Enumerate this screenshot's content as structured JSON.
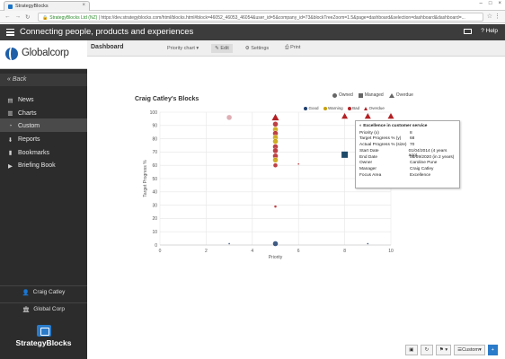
{
  "browser": {
    "tab_title": "StrategyBlocks",
    "url_secure_label": "StrategyBlocks Ltd (NZ)",
    "url": "https://dev.strategyblocks.com/html/blocks.html#block=46052_46053_46054&user_id=5&company_id=73&blockTreeZoom=1.5&page=dashboard&selection=dashboard&dashboard=..."
  },
  "app": {
    "title": "Connecting people, products and experiences",
    "help_label": "Help"
  },
  "sidebar": {
    "logo_main": "Global",
    "logo_accent": "corp",
    "back_label": "Back",
    "items": [
      {
        "label": "News",
        "icon": "newspaper-icon"
      },
      {
        "label": "Charts",
        "icon": "chart-icon"
      },
      {
        "label": "Custom",
        "icon": "dashboard-icon",
        "active": true
      },
      {
        "label": "Reports",
        "icon": "download-icon"
      },
      {
        "label": "Bookmarks",
        "icon": "bookmark-icon"
      },
      {
        "label": "Briefing Book",
        "icon": "book-icon"
      }
    ],
    "user_name": "Craig Catley",
    "company_name": "Global Corp",
    "brand": "StrategyBlocks"
  },
  "toolbar": {
    "dashboard_label": "Dashboard",
    "priority_chart": "Priority chart",
    "edit": "Edit",
    "settings": "Settings",
    "print": "Print"
  },
  "chart": {
    "title": "Craig Catley's Blocks",
    "legend_shapes": [
      "Owned",
      "Managed",
      "Overdue"
    ],
    "legend_status": [
      {
        "label": "Good",
        "color": "#1e3f6e"
      },
      {
        "label": "Warning",
        "color": "#c8a000"
      },
      {
        "label": "Bad",
        "color": "#b32024"
      },
      {
        "label": "Overdue",
        "color": "#b32024"
      }
    ],
    "xlabel": "Priority",
    "ylabel": "Target Progress %"
  },
  "chart_data": {
    "type": "scatter",
    "xlabel": "Priority",
    "ylabel": "Target Progress %",
    "xlim": [
      0,
      10
    ],
    "ylim": [
      0,
      100
    ],
    "x_ticks": [
      0,
      2,
      4,
      6,
      8,
      10
    ],
    "y_ticks": [
      0,
      10,
      20,
      30,
      40,
      50,
      60,
      70,
      80,
      90,
      100
    ],
    "points": [
      {
        "x": 3,
        "y": 96,
        "shape": "circle",
        "color": "#d9a0a8",
        "r": 3
      },
      {
        "x": 5,
        "y": 96,
        "shape": "triangle",
        "color": "#b32024",
        "r": 4
      },
      {
        "x": 5,
        "y": 91,
        "shape": "circle",
        "color": "#b32024",
        "r": 3
      },
      {
        "x": 5,
        "y": 87,
        "shape": "circle",
        "color": "#c8a000",
        "r": 3
      },
      {
        "x": 5,
        "y": 84,
        "shape": "circle",
        "color": "#b32024",
        "r": 3
      },
      {
        "x": 5,
        "y": 81,
        "shape": "circle",
        "color": "#c8a000",
        "r": 3
      },
      {
        "x": 5,
        "y": 78,
        "shape": "circle",
        "color": "#c8a000",
        "r": 3
      },
      {
        "x": 5,
        "y": 74,
        "shape": "circle",
        "color": "#b32024",
        "r": 3
      },
      {
        "x": 5,
        "y": 71,
        "shape": "circle",
        "color": "#b32024",
        "r": 3
      },
      {
        "x": 5,
        "y": 67,
        "shape": "circle",
        "color": "#b32024",
        "r": 3
      },
      {
        "x": 5,
        "y": 64,
        "shape": "circle",
        "color": "#c8a000",
        "r": 3
      },
      {
        "x": 5,
        "y": 60,
        "shape": "circle",
        "color": "#b32024",
        "r": 2.5
      },
      {
        "x": 5,
        "y": 29,
        "shape": "circle",
        "color": "#b32024",
        "r": 1.5
      },
      {
        "x": 5,
        "y": 1,
        "shape": "circle",
        "color": "#1e3f6e",
        "r": 3
      },
      {
        "x": 3,
        "y": 1,
        "shape": "circle",
        "color": "#1e3f6e",
        "r": 1
      },
      {
        "x": 6,
        "y": 61,
        "shape": "circle",
        "color": "#b32024",
        "r": 1
      },
      {
        "x": 8,
        "y": 68,
        "shape": "square",
        "color": "#1e4a6a",
        "r": 3.5
      },
      {
        "x": 8,
        "y": 97,
        "shape": "triangle",
        "color": "#b32024",
        "r": 3.5
      },
      {
        "x": 9,
        "y": 97,
        "shape": "triangle",
        "color": "#b32024",
        "r": 3.5
      },
      {
        "x": 10,
        "y": 97,
        "shape": "triangle",
        "color": "#b32024",
        "r": 3.5
      },
      {
        "x": 9,
        "y": 1,
        "shape": "circle",
        "color": "#1e3f6e",
        "r": 1
      }
    ]
  },
  "tooltip": {
    "title": "Excellence in customer service",
    "rows": [
      {
        "k": "Priority (x)",
        "v": "8"
      },
      {
        "k": "Target Progress % (y)",
        "v": "68"
      },
      {
        "k": "Actual Progress % (size)",
        "v": "70"
      },
      {
        "k": "Start Date",
        "v": "01/04/2014 (4 years ago)"
      },
      {
        "k": "End Date",
        "v": "03/09/2020 (in 2 years)"
      },
      {
        "k": "Owner",
        "v": "Caroline Pune"
      },
      {
        "k": "Manager",
        "v": "Craig Catley"
      },
      {
        "k": "Focus Area",
        "v": "Excellence"
      }
    ]
  },
  "bottom": {
    "custom_label": "Custom"
  }
}
